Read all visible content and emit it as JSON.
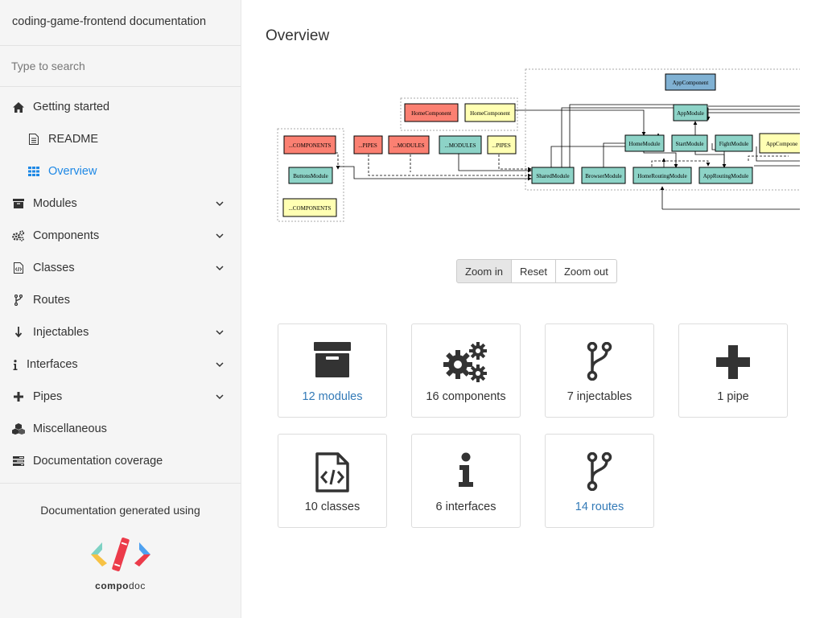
{
  "app": {
    "title": "coding-game-frontend documentation"
  },
  "search": {
    "placeholder": "Type to search"
  },
  "menu": {
    "getting_started": "Getting started",
    "readme": "README",
    "overview": "Overview",
    "modules": "Modules",
    "components": "Components",
    "classes": "Classes",
    "routes": "Routes",
    "injectables": "Injectables",
    "interfaces": "Interfaces",
    "pipes": "Pipes",
    "miscellaneous": "Miscellaneous",
    "coverage": "Documentation coverage"
  },
  "footer": {
    "generated": "Documentation generated using",
    "logo_bold": "compo",
    "logo_rest": "doc"
  },
  "main": {
    "title": "Overview"
  },
  "zoom": {
    "in": "Zoom in",
    "reset": "Reset",
    "out": "Zoom out"
  },
  "cards": [
    {
      "label": "12 modules",
      "icon": "archive-icon",
      "link": true
    },
    {
      "label": "16 components",
      "icon": "gears-icon",
      "link": false
    },
    {
      "label": "7 injectables",
      "icon": "code-fork-icon",
      "link": false
    },
    {
      "label": "1 pipe",
      "icon": "plus-icon",
      "link": false
    },
    {
      "label": "10 classes",
      "icon": "file-code-icon",
      "link": false
    },
    {
      "label": "6 interfaces",
      "icon": "info-icon",
      "link": false
    },
    {
      "label": "14 routes",
      "icon": "code-fork-icon",
      "link": true
    }
  ],
  "graph": {
    "nodes": {
      "app_component": "AppComponent",
      "app_module": "AppModule",
      "home_component_red": "HomeComponent",
      "home_component_yellow": "HomeComponent",
      "components_red": "...COMPONENTS",
      "pipes_red": "...PIPES",
      "modules_red": "...MODULES",
      "modules_green": "...MODULES",
      "pipes_yellow": "...PIPES",
      "home_module": "HomeModule",
      "start_module": "StartModule",
      "fight_module": "FightModule",
      "app_component_yellow": "AppCompone",
      "buttons_module": "ButtonsModule",
      "components_yellow": "...COMPONENTS",
      "shared_module": "SharedModule",
      "browser_module": "BrowserModule",
      "home_routing_module": "HomeRoutingModule",
      "app_routing_module": "AppRoutingModule"
    }
  },
  "colors": {
    "accent": "#1e88e5",
    "link": "#337ab7",
    "node_green": "#8dd3c7",
    "node_red": "#fb8072",
    "node_yellow": "#ffffb3",
    "node_blue": "#80b1d3"
  }
}
